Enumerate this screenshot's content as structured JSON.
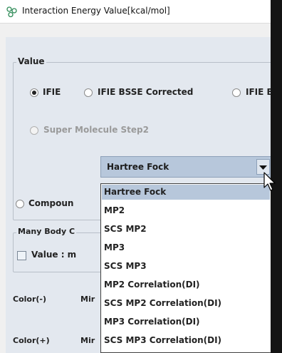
{
  "window": {
    "title": "Interaction Energy Value[kcal/mol]",
    "icon": "molecule-icon"
  },
  "value_group": {
    "label": "Value",
    "options": [
      {
        "label": "IFIE",
        "selected": true
      },
      {
        "label": "IFIE BSSE Corrected",
        "selected": false
      },
      {
        "label": "IFIE B",
        "selected": false
      }
    ],
    "super_molecule": "Super Molecule Step2",
    "compound_label": "Compoun"
  },
  "method_combo": {
    "selected": "Hartree Fock",
    "options": [
      "Hartree Fock",
      "MP2",
      "SCS MP2",
      "MP3",
      "SCS MP3",
      "MP2 Correlation(DI)",
      "SCS MP2 Correlation(DI)",
      "MP3 Correlation(DI)",
      "SCS MP3 Correlation(DI)"
    ]
  },
  "many_body": {
    "label": "Many Body C",
    "checkbox_label": "Value : m",
    "checked": false
  },
  "color_minus": {
    "label": "Color(-)",
    "min_label": "Mir"
  },
  "color_plus": {
    "label": "Color(+)",
    "min_label": "Mir",
    "trailing": "67"
  },
  "colors": {
    "accent": "#b7c7db",
    "panel": "#e3e8ef"
  }
}
